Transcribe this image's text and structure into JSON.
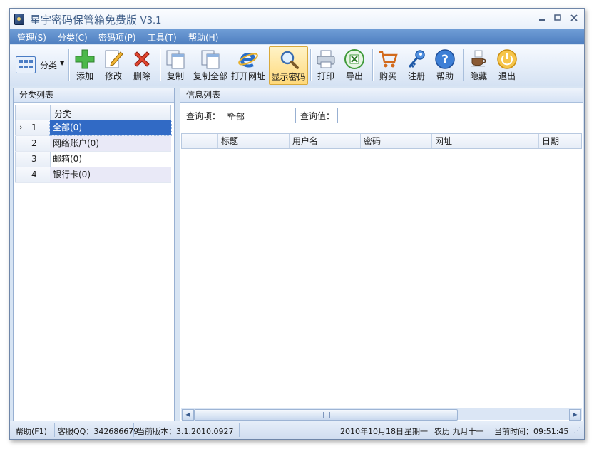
{
  "window": {
    "title": "星宇密码保管箱免费版",
    "version": "V3.1"
  },
  "menu": [
    {
      "label": "管理(S)"
    },
    {
      "label": "分类(C)"
    },
    {
      "label": "密码项(P)"
    },
    {
      "label": "工具(T)"
    },
    {
      "label": "帮助(H)"
    }
  ],
  "toolbar": {
    "category_dropdown": "分类",
    "buttons": {
      "add": "添加",
      "edit": "修改",
      "delete": "删除",
      "copy": "复制",
      "copy_all": "复制全部",
      "open_url": "打开网址",
      "show_password": "显示密码",
      "print": "打印",
      "export": "导出",
      "buy": "购买",
      "register": "注册",
      "help": "帮助",
      "hide": "隐藏",
      "exit": "退出"
    }
  },
  "left_panel": {
    "title": "分类列表",
    "column_header": "分类",
    "rows": [
      {
        "index": "1",
        "name": "全部(0)"
      },
      {
        "index": "2",
        "name": "网络账户(0)"
      },
      {
        "index": "3",
        "name": "邮箱(0)"
      },
      {
        "index": "4",
        "name": "银行卡(0)"
      }
    ],
    "selected_row": 1
  },
  "right_panel": {
    "title": "信息列表",
    "query_field_label": "查询项：",
    "query_field_value": "全部",
    "query_value_label": "查询值：",
    "query_value": "",
    "columns": [
      "标题",
      "用户名",
      "密码",
      "网址",
      "日期"
    ]
  },
  "status_bar": {
    "help": "帮助(F1)",
    "support_qq": "客服QQ：342686679",
    "version": "当前版本：3.1.2010.0927",
    "date": "2010年10月18日",
    "weekday": "星期一",
    "lunar": "农历 九月十一",
    "time": "当前时间：09:51:45"
  },
  "colors": {
    "menu_bar": "#5b8ccb",
    "selected_row": "#316ac5",
    "accent_active_button": "#ffd97a"
  }
}
